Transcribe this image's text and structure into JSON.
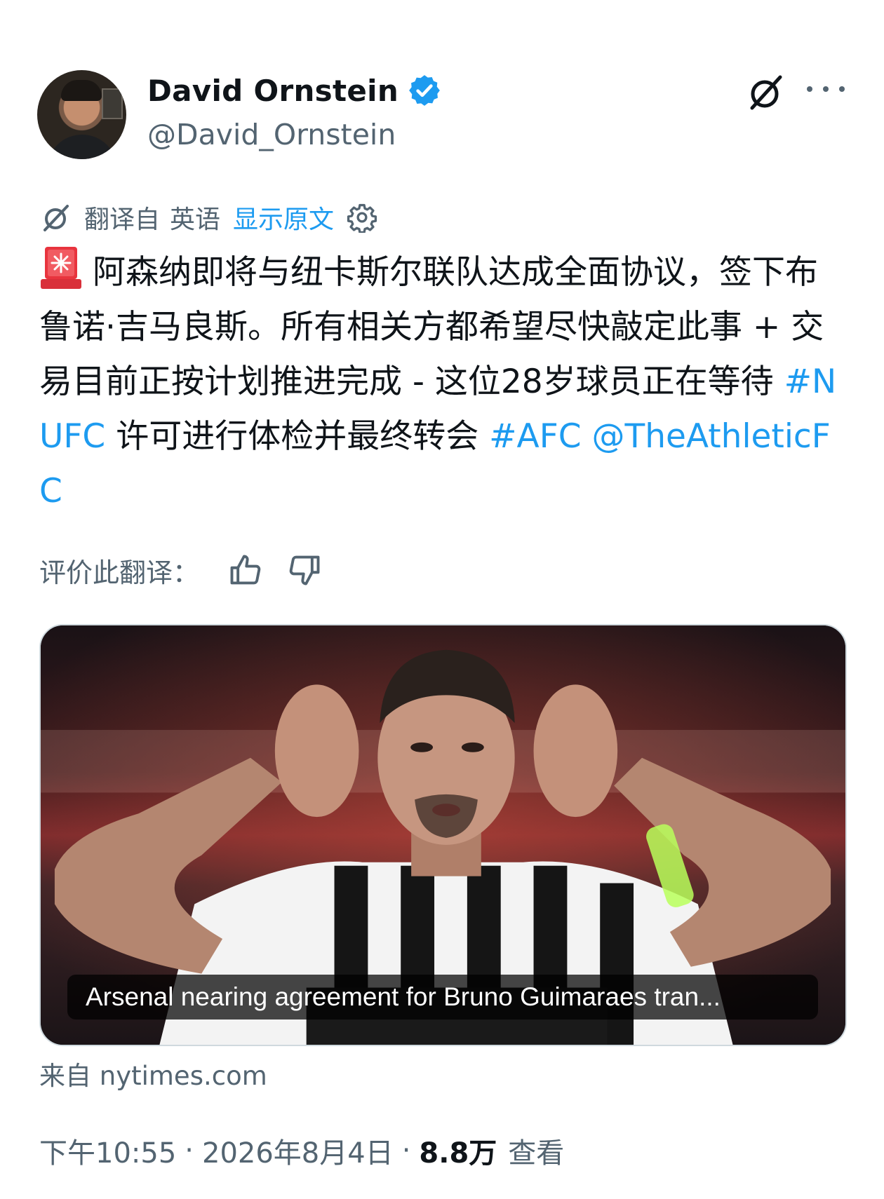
{
  "author": {
    "display_name": "David Ornstein",
    "handle": "@David_Ornstein",
    "verified": true
  },
  "translation": {
    "label": "翻译自",
    "language": "英语",
    "show_original": "显示原文"
  },
  "tweet": {
    "line1": "阿森纳即将与纽卡斯尔联队达成全面协议，签下布鲁诺·吉马良斯。所有相关方都希望尽快敲定此事 + 交易目前正按计划推进完成 - 这位28岁球员正在等待 ",
    "hashtag_nufc": "#NUFC",
    "line2": " 许可进行体检并最终转会 ",
    "hashtag_afc": "#AFC",
    "mention": "@TheAthleticFC"
  },
  "rate": {
    "label": "评价此翻译："
  },
  "card": {
    "caption": "Arsenal nearing agreement for Bruno Guimaraes tran...",
    "source": "来自 nytimes.com"
  },
  "meta": {
    "time": "下午10:55",
    "separator1": "·",
    "date": "2026年8月4日",
    "separator2": "·",
    "views_count": "8.8万",
    "views_label": "查看"
  },
  "colors": {
    "link": "#1d9bf0",
    "secondary_text": "#536471",
    "primary_text": "#0f1419"
  }
}
